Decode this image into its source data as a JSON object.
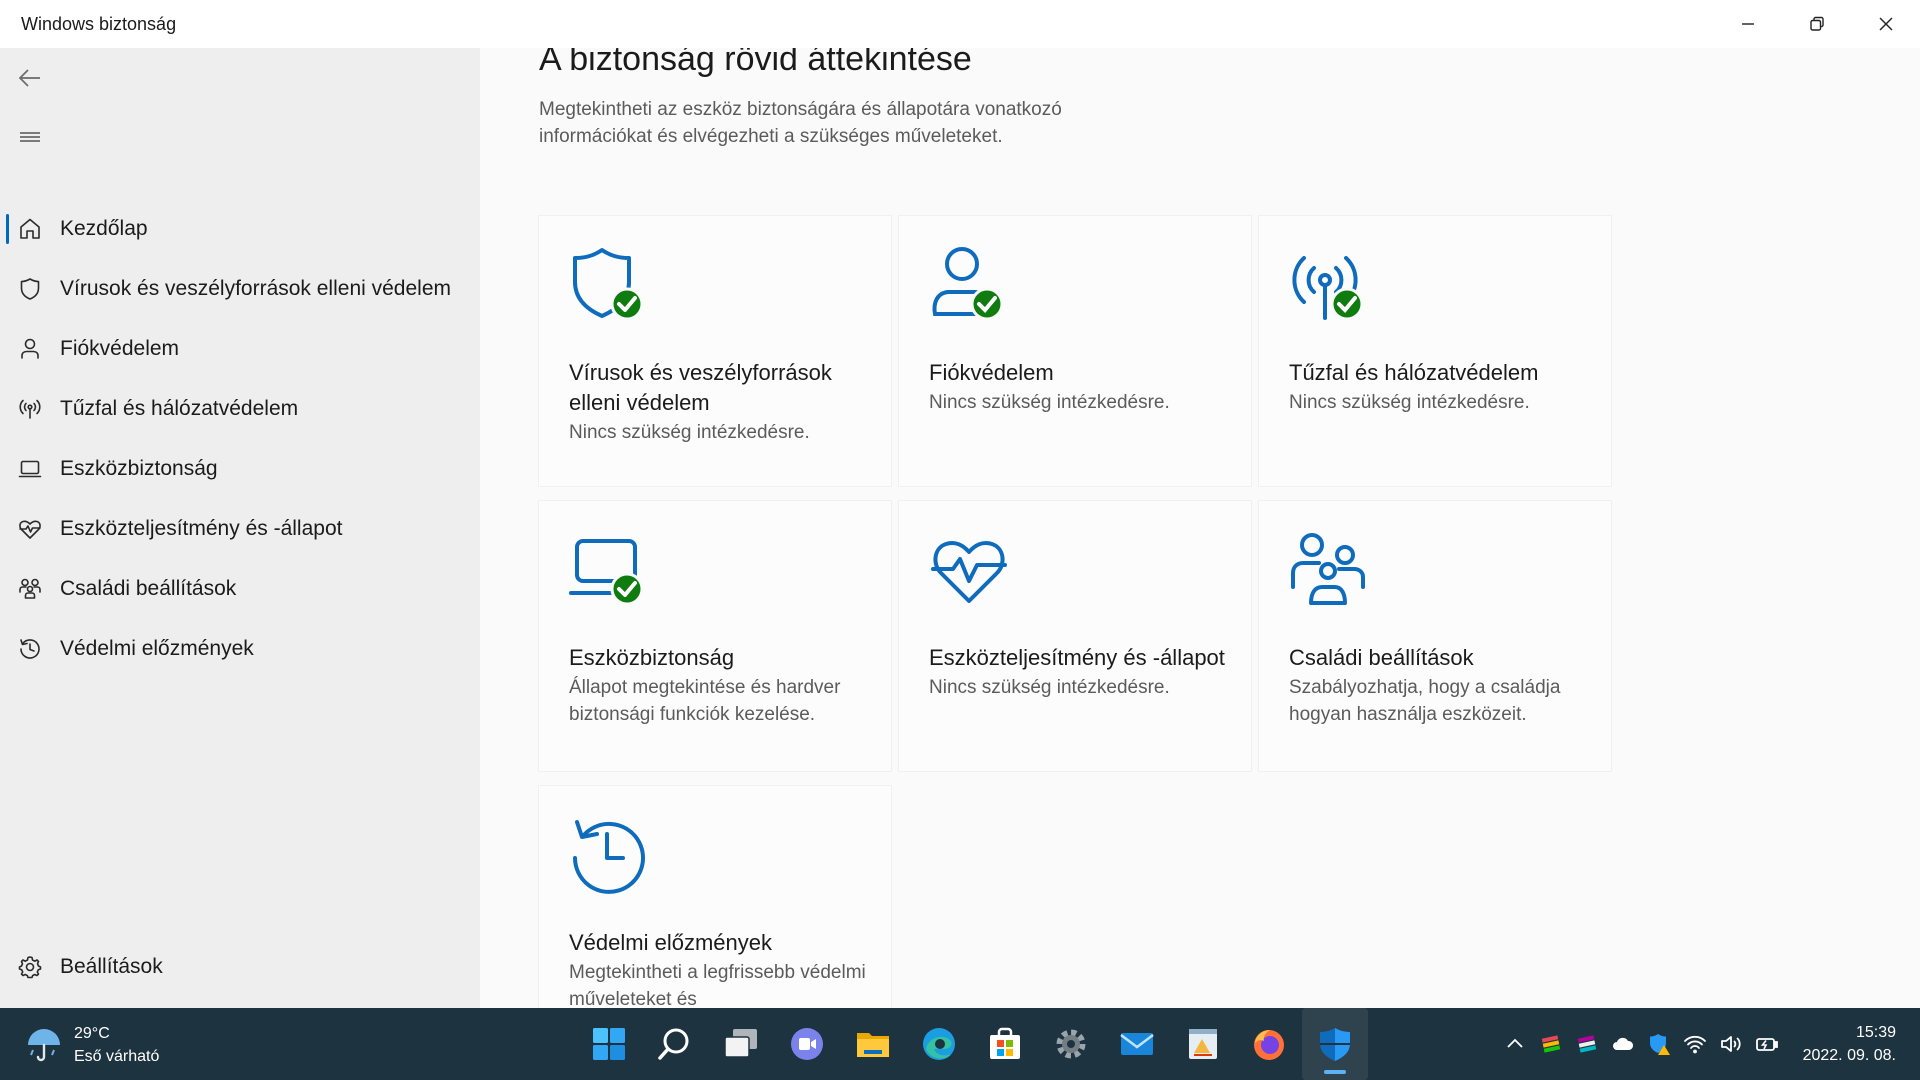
{
  "window": {
    "title": "Windows biztonság"
  },
  "sidebar": {
    "items": [
      {
        "label": "Kezdőlap",
        "icon": "home-icon",
        "active": true
      },
      {
        "label": "Vírusok és veszélyforrások elleni védelem",
        "icon": "shield-icon"
      },
      {
        "label": "Fiókvédelem",
        "icon": "person-icon"
      },
      {
        "label": "Tűzfal és hálózatvédelem",
        "icon": "antenna-icon"
      },
      {
        "label": "Eszközbiztonság",
        "icon": "laptop-icon"
      },
      {
        "label": "Eszközteljesítmény és -állapot",
        "icon": "heart-icon"
      },
      {
        "label": "Családi beállítások",
        "icon": "family-icon"
      },
      {
        "label": "Védelmi előzmények",
        "icon": "history-icon"
      }
    ],
    "settings_label": "Beállítások"
  },
  "main": {
    "title": "A biztonság rövid áttekintése",
    "description": "Megtekintheti az eszköz biztonságára és állapotára vonatkozó információkat és elvégezheti a szükséges műveleteket.",
    "cards": [
      {
        "title": "Vírusok és veszélyforrások elleni védelem",
        "status": "Nincs szükség intézkedésre.",
        "icon": "shield-check-icon"
      },
      {
        "title": "Fiókvédelem",
        "status": "Nincs szükség intézkedésre.",
        "icon": "person-check-icon"
      },
      {
        "title": "Tűzfal és hálózatvédelem",
        "status": "Nincs szükség intézkedésre.",
        "icon": "antenna-check-icon"
      },
      {
        "title": "Eszközbiztonság",
        "status": "Állapot megtekintése és hardver biztonsági funkciók kezelése.",
        "icon": "laptop-check-icon"
      },
      {
        "title": "Eszközteljesítmény és -állapot",
        "status": "Nincs szükség intézkedésre.",
        "icon": "heart-pulse-icon"
      },
      {
        "title": "Családi beállítások",
        "status": "Szabályozhatja, hogy a családja hogyan használja eszközeit.",
        "icon": "family-icon"
      },
      {
        "title": "Védelmi előzmények",
        "status": "Megtekintheti a legfrissebb védelmi műveleteket és",
        "icon": "history-icon"
      }
    ]
  },
  "colors": {
    "accent": "#0067c0",
    "icon_blue": "#0f6cbd",
    "check_green": "#107c10",
    "taskbar": "#1e3340"
  },
  "taskbar": {
    "weather": {
      "temp": "29°C",
      "condition": "Eső várható"
    },
    "apps": [
      "start-icon",
      "search-icon",
      "task-view-icon",
      "teams-chat-icon",
      "file-explorer-icon",
      "edge-icon",
      "store-icon",
      "settings-icon",
      "mail-icon",
      "paint-icon",
      "firefox-icon",
      "windows-security-icon"
    ],
    "clock": {
      "time": "15:39",
      "date": "2022. 09. 08."
    }
  }
}
